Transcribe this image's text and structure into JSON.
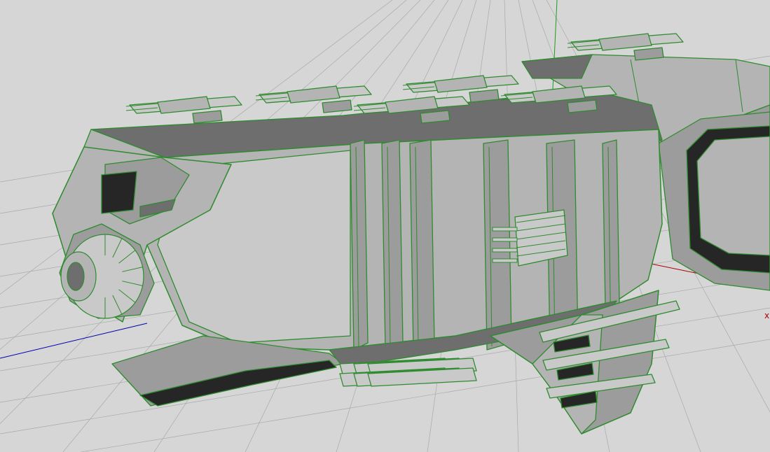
{
  "viewport": {
    "background": "#d6d6d6",
    "grid_color": "#a9a9a9",
    "axis_colors": {
      "x": "#b00000",
      "y": "#1f9a1f",
      "z": "#0000b0"
    },
    "axis_label_x": "x"
  },
  "model": {
    "wire_color": "#2e8b2e",
    "face_colors": {
      "light": "#c9c9c9",
      "mid": "#b4b4b4",
      "shade": "#9c9c9c",
      "dark": "#6e6e6e",
      "hole": "#262626"
    },
    "engines": 6,
    "side_guns": 4
  }
}
